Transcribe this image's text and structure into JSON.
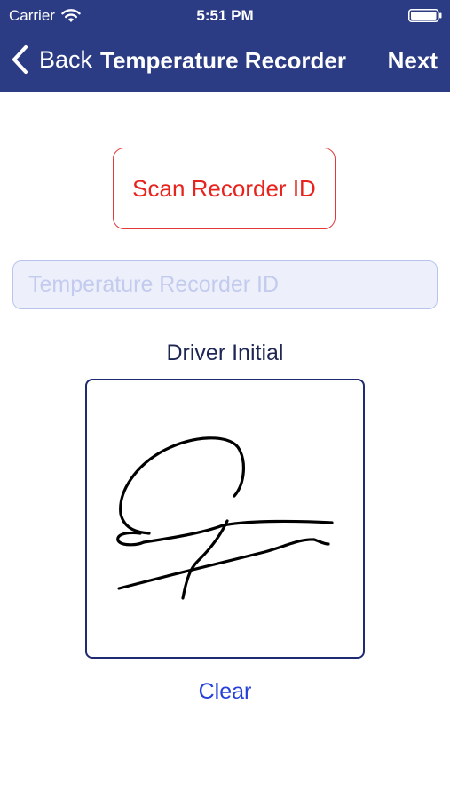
{
  "status_bar": {
    "carrier": "Carrier",
    "time": "5:51 PM",
    "wifi_icon": "wifi-icon",
    "battery_icon": "battery-full-icon"
  },
  "nav": {
    "back_icon": "chevron-left-icon",
    "back_label": "Back",
    "title": "Temperature Recorder",
    "next_label": "Next"
  },
  "scan": {
    "button_label": "Scan Recorder ID"
  },
  "recorder_id": {
    "value": "",
    "placeholder": "Temperature Recorder ID"
  },
  "signature": {
    "label": "Driver Initial",
    "clear_label": "Clear",
    "has_signature": true
  },
  "colors": {
    "nav_background": "#2c3c84",
    "scan_button_text": "#e8221c",
    "clear_link": "#2540d9",
    "signature_border": "#1f2a70"
  }
}
